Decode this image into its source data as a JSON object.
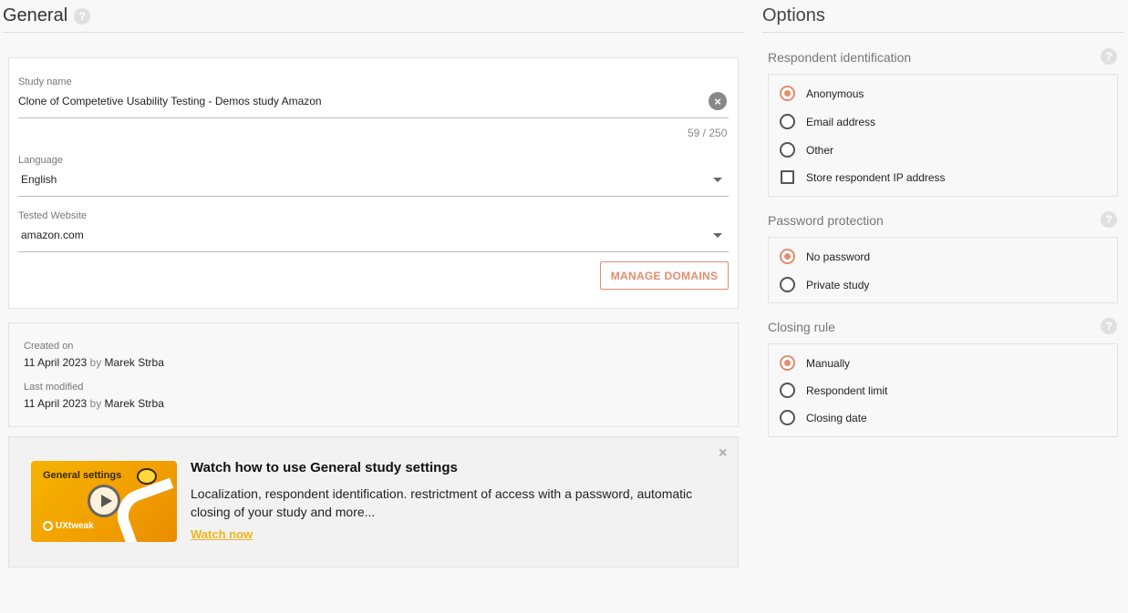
{
  "general": {
    "title": "General",
    "help": "?",
    "study_name_label": "Study name",
    "study_name_value": "Clone of Competetive Usability Testing - Demos study Amazon",
    "clear_glyph": "×",
    "counter": "59 / 250",
    "language_label": "Language",
    "language_value": "English",
    "website_label": "Tested Website",
    "website_value": "amazon.com",
    "manage_domains": "MANAGE DOMAINS"
  },
  "meta": {
    "created_label": "Created on",
    "created_date": "11 April 2023",
    "created_by_word": "by",
    "created_by": "Marek Strba",
    "modified_label": "Last modified",
    "modified_date": "11 April 2023",
    "modified_by_word": "by",
    "modified_by": "Marek Strba"
  },
  "promo": {
    "thumb_title": "General settings",
    "thumb_brand": "UXtweak",
    "title": "Watch how to use General study settings",
    "text": "Localization, respondent identification. restrictment of access with a password, automatic closing of your study and more...",
    "link": "Watch now",
    "close": "×"
  },
  "options": {
    "title": "Options",
    "respondent": {
      "heading": "Respondent identification",
      "help": "?",
      "items": [
        "Anonymous",
        "Email address",
        "Other"
      ],
      "selected": "Anonymous",
      "checkbox": "Store respondent IP address"
    },
    "password": {
      "heading": "Password protection",
      "help": "?",
      "items": [
        "No password",
        "Private study"
      ],
      "selected": "No password"
    },
    "closing": {
      "heading": "Closing rule",
      "help": "?",
      "items": [
        "Manually",
        "Respondent limit",
        "Closing date"
      ],
      "selected": "Manually"
    }
  },
  "colors": {
    "accent": "#e38d6c",
    "link": "#f2b21b"
  }
}
